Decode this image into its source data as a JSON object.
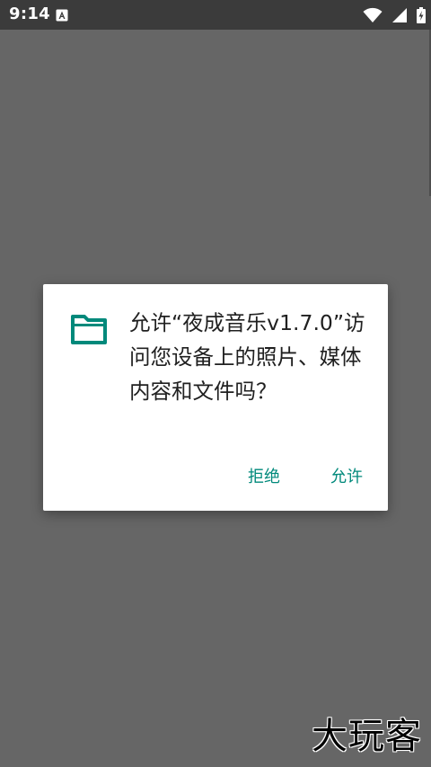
{
  "status_bar": {
    "time": "9:14",
    "icons": [
      "notification-a-icon",
      "wifi-icon",
      "signal-icon",
      "battery-charging-icon"
    ]
  },
  "dialog": {
    "icon": "folder-icon",
    "message": "允许“夜成音乐v1.7.0”访问您设备上的照片、媒体内容和文件吗？",
    "deny_label": "拒绝",
    "allow_label": "允许"
  },
  "watermark": {
    "text": "大玩客"
  },
  "colors": {
    "accent": "#00897b",
    "scrim": "#666666",
    "status_bar": "#3b3b3b",
    "dialog_bg": "#ffffff"
  }
}
